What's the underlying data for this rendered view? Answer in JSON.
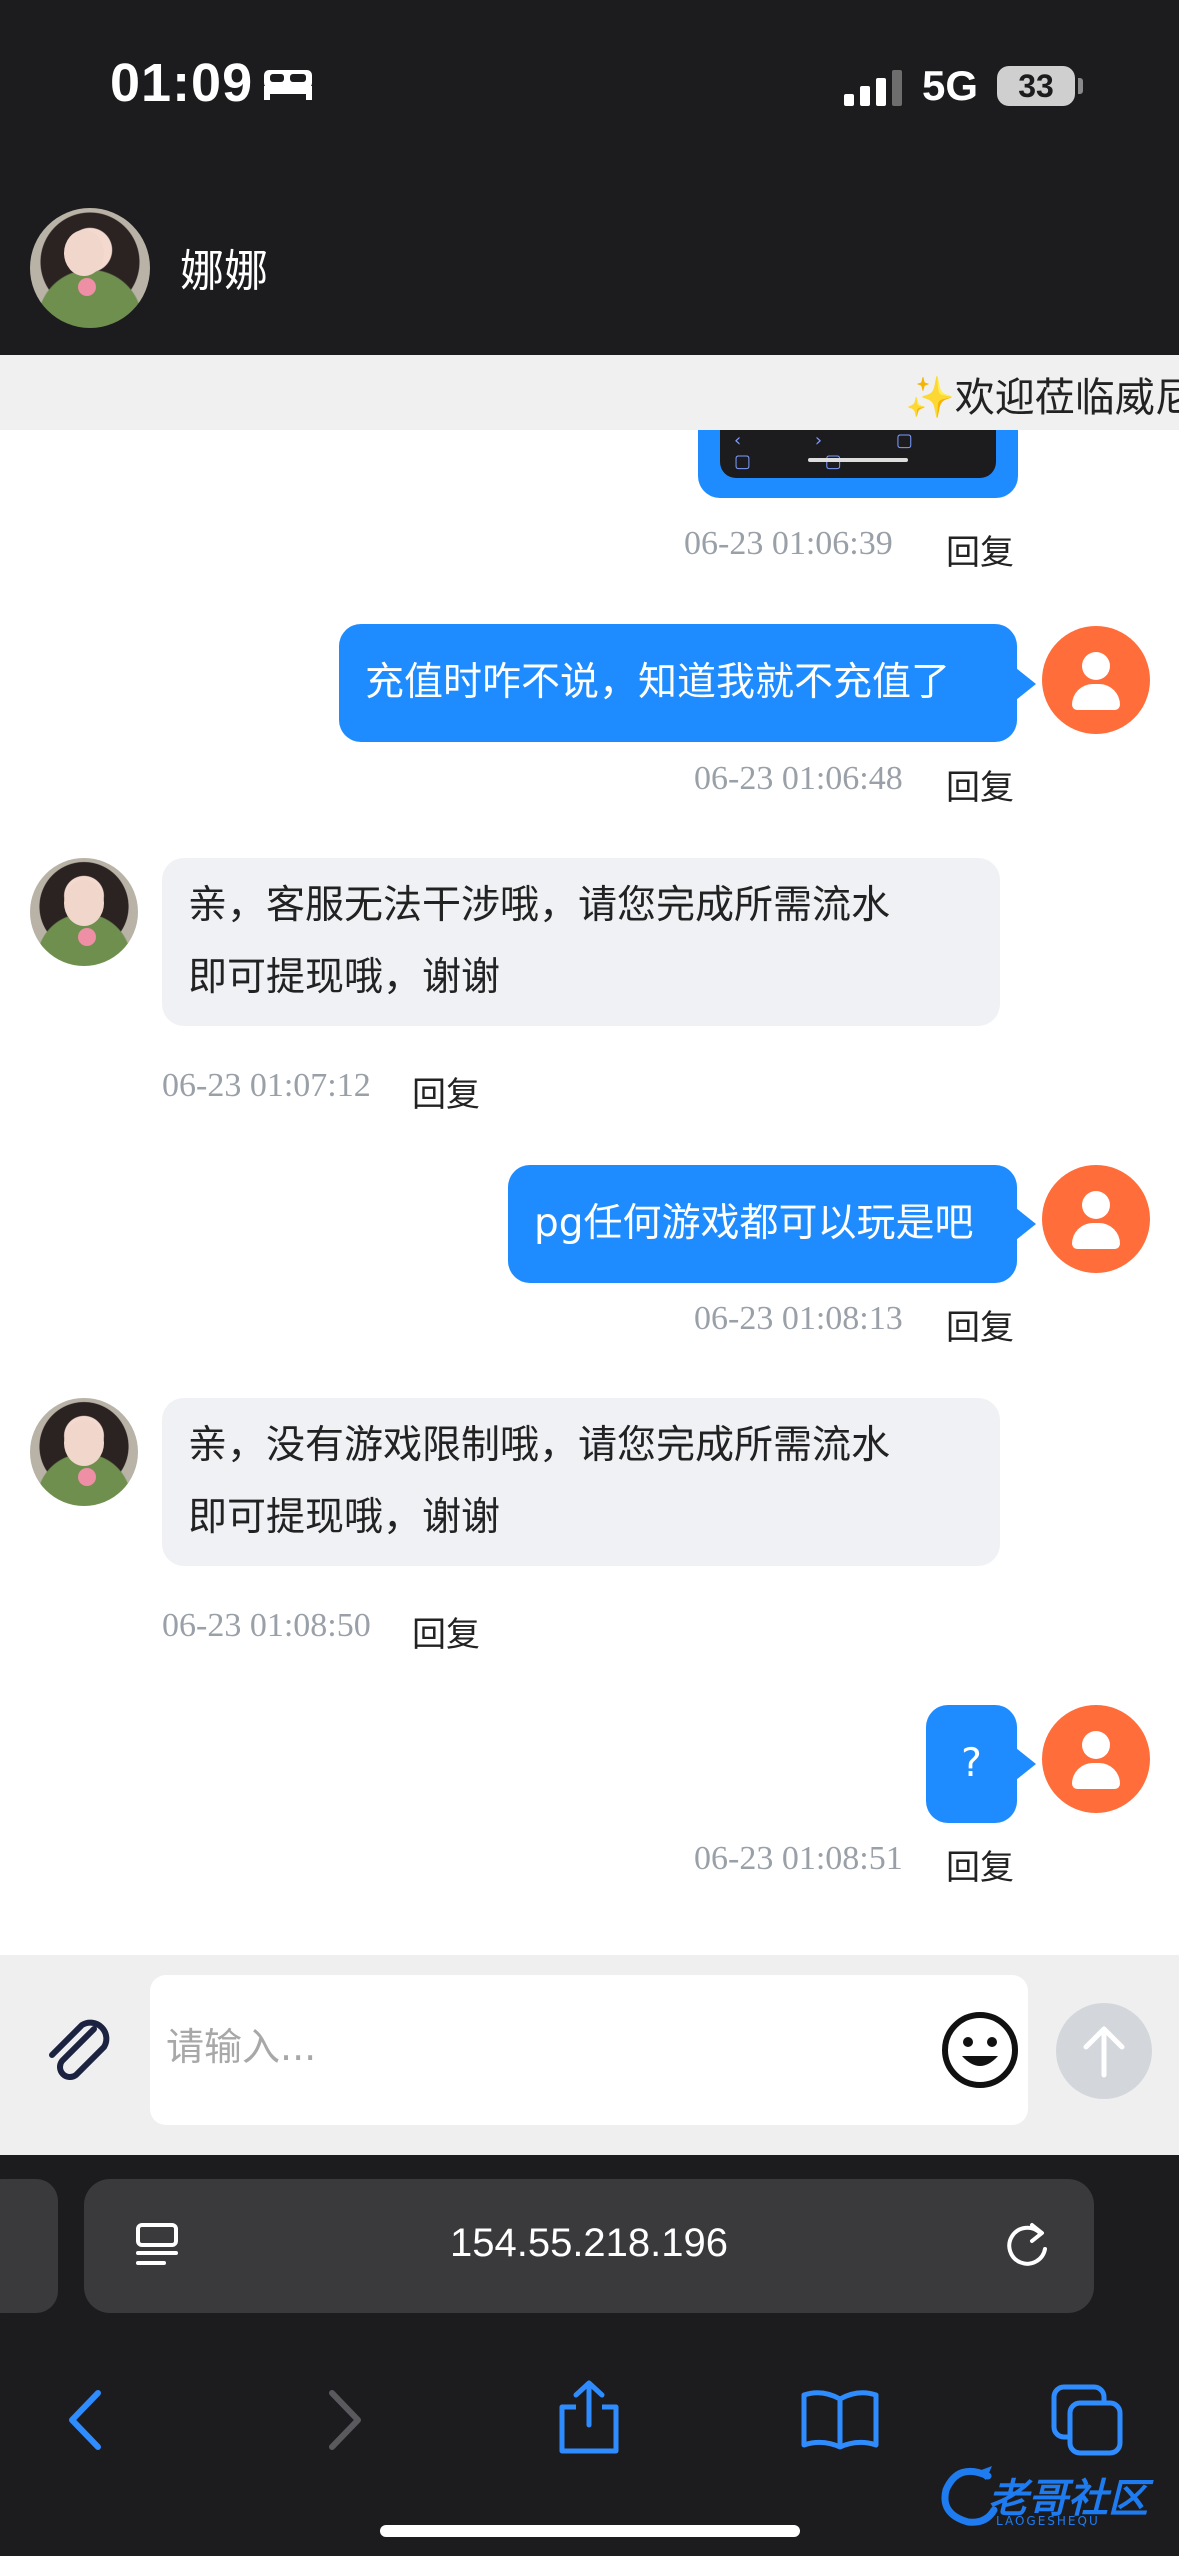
{
  "status_bar": {
    "time": "01:09",
    "network": "5G",
    "battery": "33",
    "icons": [
      "bed-icon",
      "signal-icon",
      "battery-icon"
    ]
  },
  "header": {
    "contact_name": "娜娜"
  },
  "marquee": {
    "text": "✨欢迎莅临威尼"
  },
  "messages": [
    {
      "side": "out",
      "type": "image",
      "time": "06-23 01:06:39",
      "reply": "回复"
    },
    {
      "side": "out",
      "text": "充值时咋不说，知道我就不充值了",
      "time": "06-23 01:06:48",
      "reply": "回复"
    },
    {
      "side": "in",
      "line1": "亲，客服无法干涉哦，请您完成所需流水",
      "line2": "即可提现哦，谢谢",
      "time": "06-23 01:07:12",
      "reply": "回复"
    },
    {
      "side": "out",
      "text": "pg任何游戏都可以玩是吧",
      "time": "06-23 01:08:13",
      "reply": "回复"
    },
    {
      "side": "in",
      "line1": "亲，没有游戏限制哦，请您完成所需流水",
      "line2": "即可提现哦，谢谢",
      "time": "06-23 01:08:50",
      "reply": "回复"
    },
    {
      "side": "out",
      "text": "?",
      "time": "06-23 01:08:51",
      "reply": "回复"
    }
  ],
  "input": {
    "placeholder": "请输入...",
    "value": ""
  },
  "browser": {
    "url": "154.55.218.196",
    "toolbar": [
      "back-icon",
      "forward-icon",
      "share-icon",
      "bookmarks-icon",
      "tabs-icon"
    ]
  },
  "watermark": {
    "text": "老哥社区",
    "sub": "LAOGESHEQU"
  },
  "colors": {
    "outgoing_bubble": "#1e8cff",
    "incoming_bubble": "#eff1f4",
    "user_avatar": "#ff6d3b",
    "chrome_dark": "#1c1c1e"
  }
}
